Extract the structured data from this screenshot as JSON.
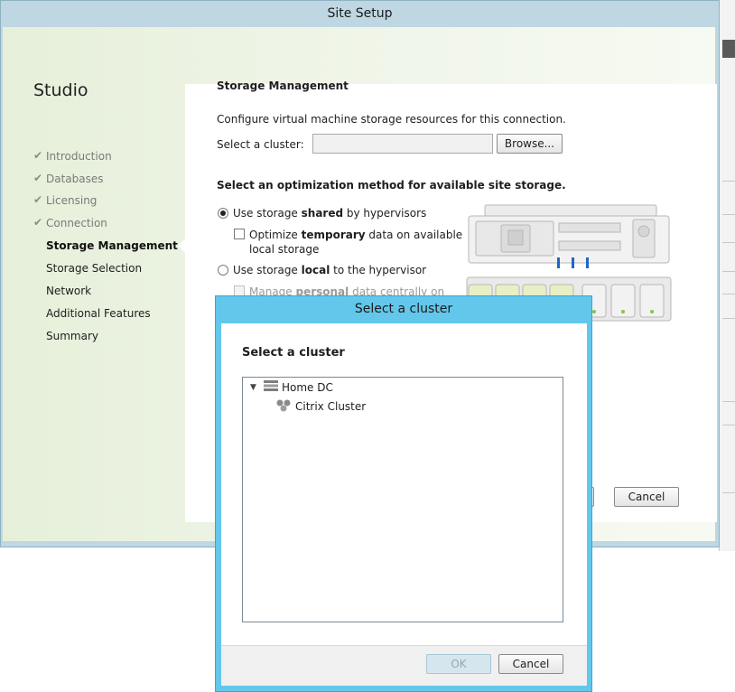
{
  "window": {
    "title": "Site Setup",
    "brand": "Studio",
    "colors": {
      "title_bar": "#bfd7e2",
      "dialog_frame": "#62c7ea"
    }
  },
  "nav": {
    "items": [
      {
        "label": "Introduction",
        "state": "done"
      },
      {
        "label": "Databases",
        "state": "done"
      },
      {
        "label": "Licensing",
        "state": "done"
      },
      {
        "label": "Connection",
        "state": "done"
      },
      {
        "label": "Storage Management",
        "state": "active"
      },
      {
        "label": "Storage Selection",
        "state": "pending"
      },
      {
        "label": "Network",
        "state": "pending"
      },
      {
        "label": "Additional Features",
        "state": "pending"
      },
      {
        "label": "Summary",
        "state": "pending"
      }
    ]
  },
  "page": {
    "heading": "Storage Management",
    "intro": "Configure virtual machine storage resources for this connection.",
    "cluster_label": "Select a cluster:",
    "cluster_value": "",
    "browse_label": "Browse...",
    "optimization_heading": "Select an optimization method for available site storage.",
    "option_shared": {
      "pre": "Use storage ",
      "bold": "shared",
      "post": " by hypervisors",
      "selected": true
    },
    "option_temp": {
      "pre": "Optimize ",
      "bold": "temporary",
      "post": " data on available",
      "line2": "local storage",
      "checked": false
    },
    "option_local": {
      "pre": "Use storage ",
      "bold": "local",
      "post": " to the hypervisor",
      "selected": false
    },
    "option_personal": {
      "pre": "Manage ",
      "bold": "personal",
      "post": " data centrally on",
      "checked": false,
      "enabled": false
    },
    "cancel_label": "Cancel"
  },
  "dialog": {
    "title": "Select a cluster",
    "heading": "Select a cluster",
    "tree": [
      {
        "label": "Home DC",
        "icon": "datacenter-icon",
        "expanded": true,
        "children": [
          {
            "label": "Citrix Cluster",
            "icon": "cluster-icon"
          }
        ]
      }
    ],
    "ok_label": "OK",
    "ok_enabled": false,
    "cancel_label": "Cancel"
  }
}
